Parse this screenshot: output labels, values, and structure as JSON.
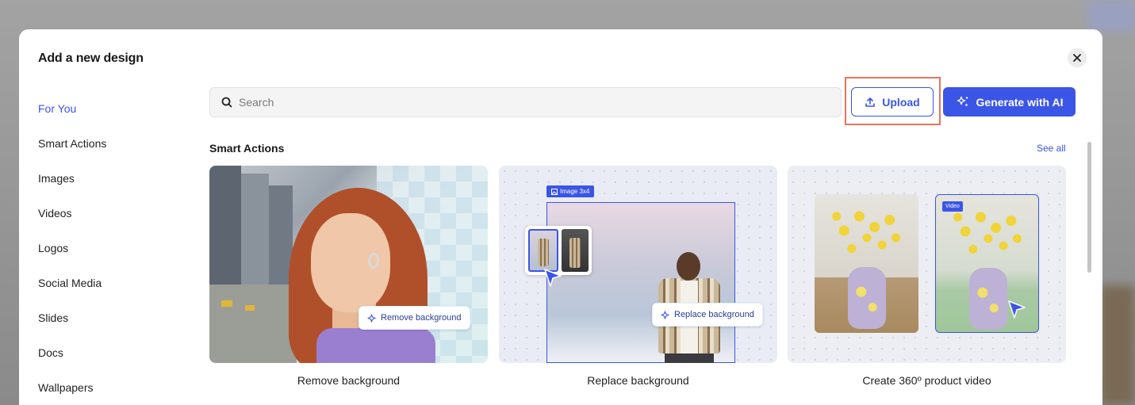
{
  "modal": {
    "title": "Add a new design"
  },
  "sidebar": {
    "items": [
      {
        "label": "For You",
        "active": true
      },
      {
        "label": "Smart Actions"
      },
      {
        "label": "Images"
      },
      {
        "label": "Videos"
      },
      {
        "label": "Logos"
      },
      {
        "label": "Social Media"
      },
      {
        "label": "Slides"
      },
      {
        "label": "Docs"
      },
      {
        "label": "Wallpapers"
      }
    ]
  },
  "toolbar": {
    "search_placeholder": "Search",
    "upload_label": "Upload",
    "generate_label": "Generate with AI"
  },
  "section": {
    "title": "Smart Actions",
    "see_all": "See all"
  },
  "cards": [
    {
      "label": "Remove background",
      "pill": "Remove background"
    },
    {
      "label": "Replace background",
      "pill": "Replace background",
      "tag": "Image 3x4"
    },
    {
      "label": "Create 360º product video",
      "tag": "Video"
    }
  ],
  "colors": {
    "accent": "#3b55e6",
    "highlight": "#e8735a"
  }
}
